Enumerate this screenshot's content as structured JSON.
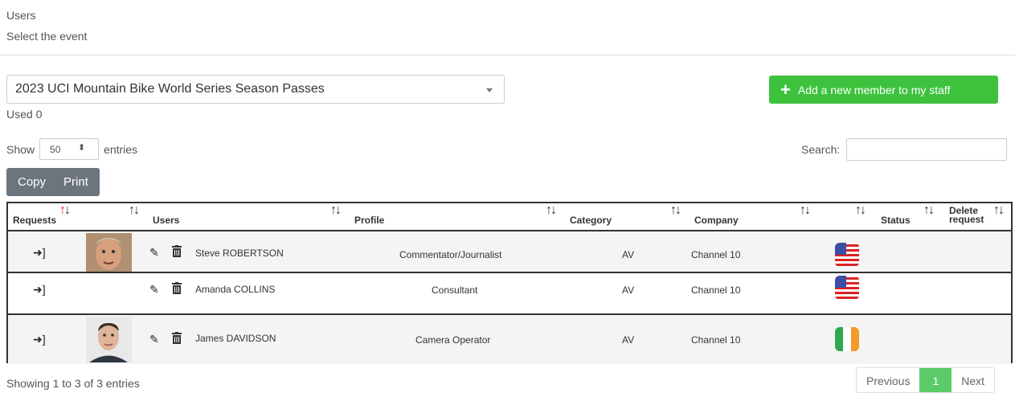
{
  "header": {
    "title": "Users",
    "subtitle": "Select the event"
  },
  "event_select": {
    "selected": "2023 UCI Mountain Bike World Series Season Passes"
  },
  "used_text": "Used 0",
  "add_button": {
    "label": "Add a new member to my staff"
  },
  "length": {
    "show_label": "Show",
    "value": "50",
    "entries_label": "entries"
  },
  "search": {
    "label": "Search:",
    "value": ""
  },
  "export_buttons": {
    "copy": "Copy",
    "print": "Print"
  },
  "table": {
    "columns": [
      "Requests",
      "Users",
      "Profile",
      "Category",
      "Company",
      "Status",
      "Delete request"
    ],
    "delete_header": {
      "line1": "Delete",
      "line2": "request"
    },
    "rows": [
      {
        "name": "Steve ROBERTSON",
        "profile": "Commentator/Journalist",
        "category": "AV",
        "company": "Channel 10",
        "flag": "us-flag",
        "photo": true
      },
      {
        "name": "Amanda COLLINS",
        "profile": "Consultant",
        "category": "AV",
        "company": "Channel 10",
        "flag": "us-flag",
        "photo": false
      },
      {
        "name": "James DAVIDSON",
        "profile": "Camera Operator",
        "category": "AV",
        "company": "Channel 10",
        "flag": "ireland-flag",
        "photo": true
      }
    ]
  },
  "footer": {
    "info": "Showing 1 to 3 of 3 entries"
  },
  "pagination": {
    "previous": "Previous",
    "current": "1",
    "next": "Next"
  },
  "colors": {
    "accent_green": "#3ec23e",
    "export_gray": "#6c757d",
    "active_page": "#5ccc6b"
  }
}
